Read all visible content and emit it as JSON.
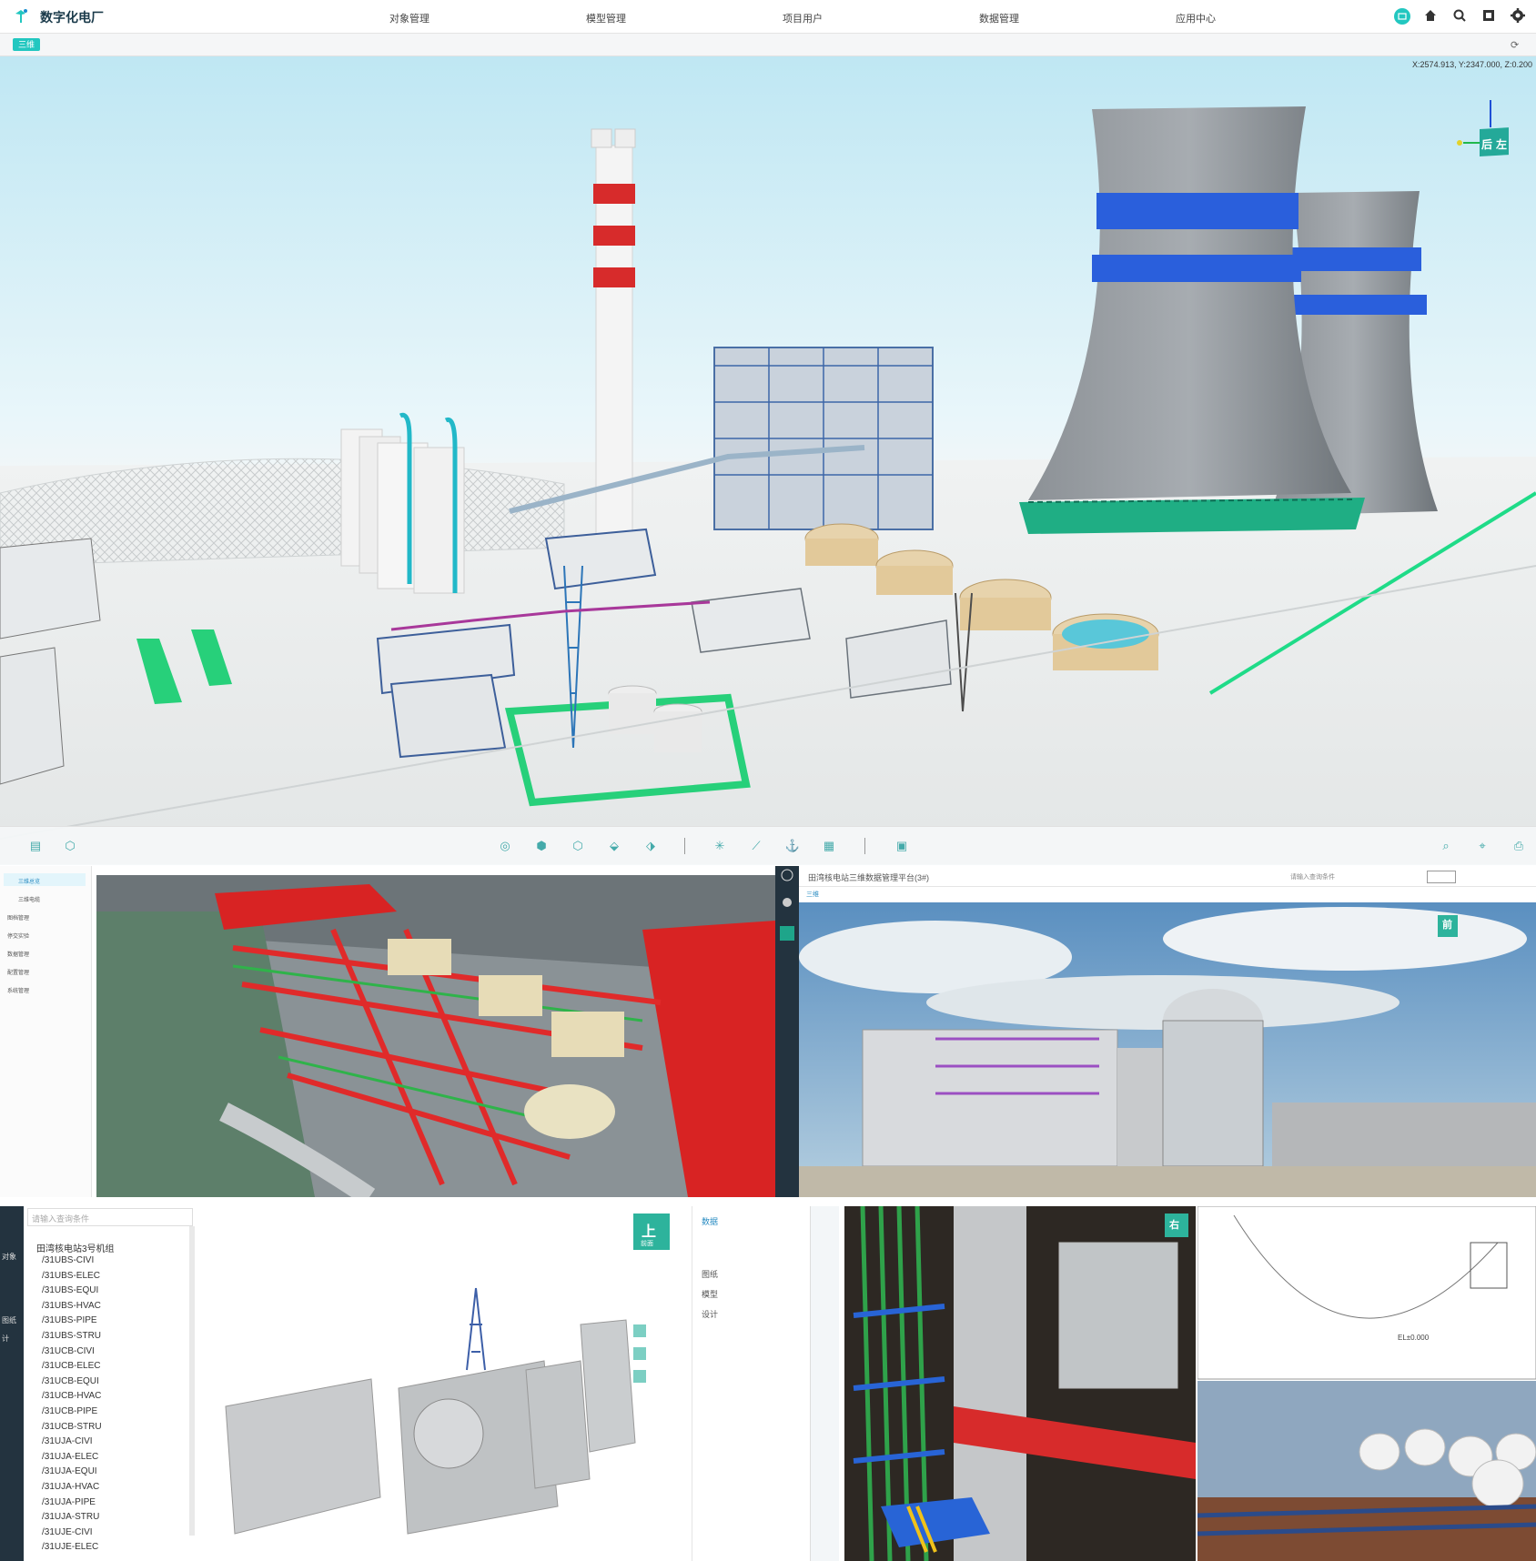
{
  "app": {
    "title": "数字化电厂",
    "nav": [
      "对象管理",
      "模型管理",
      "项目用户",
      "数据管理",
      "应用中心"
    ],
    "header_icons": [
      "user-badge-icon",
      "home-icon",
      "search-icon",
      "fullscreen-icon",
      "settings-icon"
    ],
    "accent": "#22c7c0"
  },
  "subbar": {
    "tab": "三维",
    "refresh_icon": "refresh-icon"
  },
  "viewport": {
    "coords": "X:2574.913, Y:2347.000, Z:0.200",
    "nav_cube_labels": [
      "后",
      "左"
    ]
  },
  "toolbar": {
    "left_icons": [
      "layers-icon",
      "model-cube-icon"
    ],
    "center_icons": [
      "locate-icon",
      "cube-solid-icon",
      "cube-outline-icon",
      "cube-measure-icon",
      "cube-section-icon",
      "network-icon",
      "measure-line-icon",
      "anchor-icon",
      "grid-icon",
      "frame-icon"
    ],
    "right_icons": [
      "zoom-icon",
      "pin-icon",
      "camera-icon"
    ]
  },
  "panel_b": {
    "sidebar": [
      "三维总览",
      "三维电缆",
      "图档管理",
      "停交实验",
      "数据管理",
      "配置管理",
      "系统管理"
    ]
  },
  "panel_c": {
    "title": "田湾核电站三维数据管理平台(3#)",
    "search_placeholder": "请输入查询条件",
    "tab": "三维",
    "nav_cube": "前"
  },
  "panel_d": {
    "search_placeholder": "请输入查询条件",
    "tree_root": "田湾核电站3号机组",
    "tree": [
      "/31UBS-CIVI",
      "/31UBS-ELEC",
      "/31UBS-EQUI",
      "/31UBS-HVAC",
      "/31UBS-PIPE",
      "/31UBS-STRU",
      "/31UCB-CIVI",
      "/31UCB-ELEC",
      "/31UCB-EQUI",
      "/31UCB-HVAC",
      "/31UCB-PIPE",
      "/31UCB-STRU",
      "/31UJA-CIVI",
      "/31UJA-ELEC",
      "/31UJA-EQUI",
      "/31UJA-HVAC",
      "/31UJA-PIPE",
      "/31UJA-STRU",
      "/31UJE-CIVI",
      "/31UJE-ELEC"
    ],
    "left_labels": [
      "对象",
      "图纸",
      "计"
    ],
    "nav_cube": "上",
    "nav_cube_sub": "前面",
    "right_panel": [
      "数据",
      "图纸",
      "模型",
      "设计"
    ]
  },
  "panel_e": {
    "nav_cube": "右"
  },
  "panel_f": {
    "drawing_label": "EL±0.000"
  }
}
